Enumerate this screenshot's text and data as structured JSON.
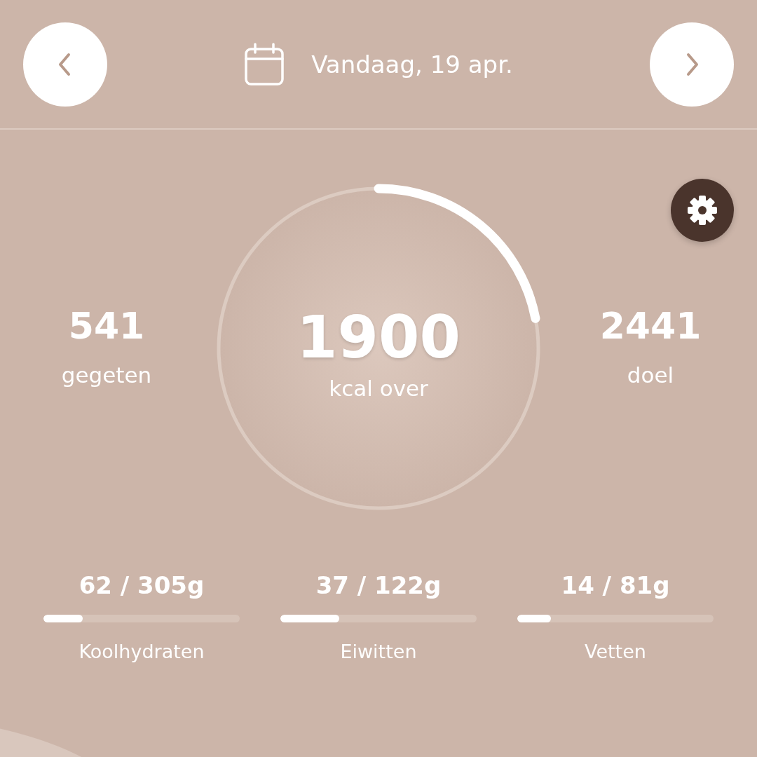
{
  "header": {
    "date": "Vandaag, 19 apr."
  },
  "summary": {
    "eaten": {
      "value": "541",
      "label": "gegeten"
    },
    "remaining": {
      "value": "1900",
      "label": "kcal over"
    },
    "goal": {
      "value": "2441",
      "label": "doel"
    }
  },
  "macros": [
    {
      "amount": "62 / 305g",
      "name": "Koolhydraten",
      "level": 0.2
    },
    {
      "amount": "37 / 122g",
      "name": "Eiwitten",
      "level": 0.3
    },
    {
      "amount": "14 / 81g",
      "name": "Vetten",
      "level": 0.17
    }
  ]
}
